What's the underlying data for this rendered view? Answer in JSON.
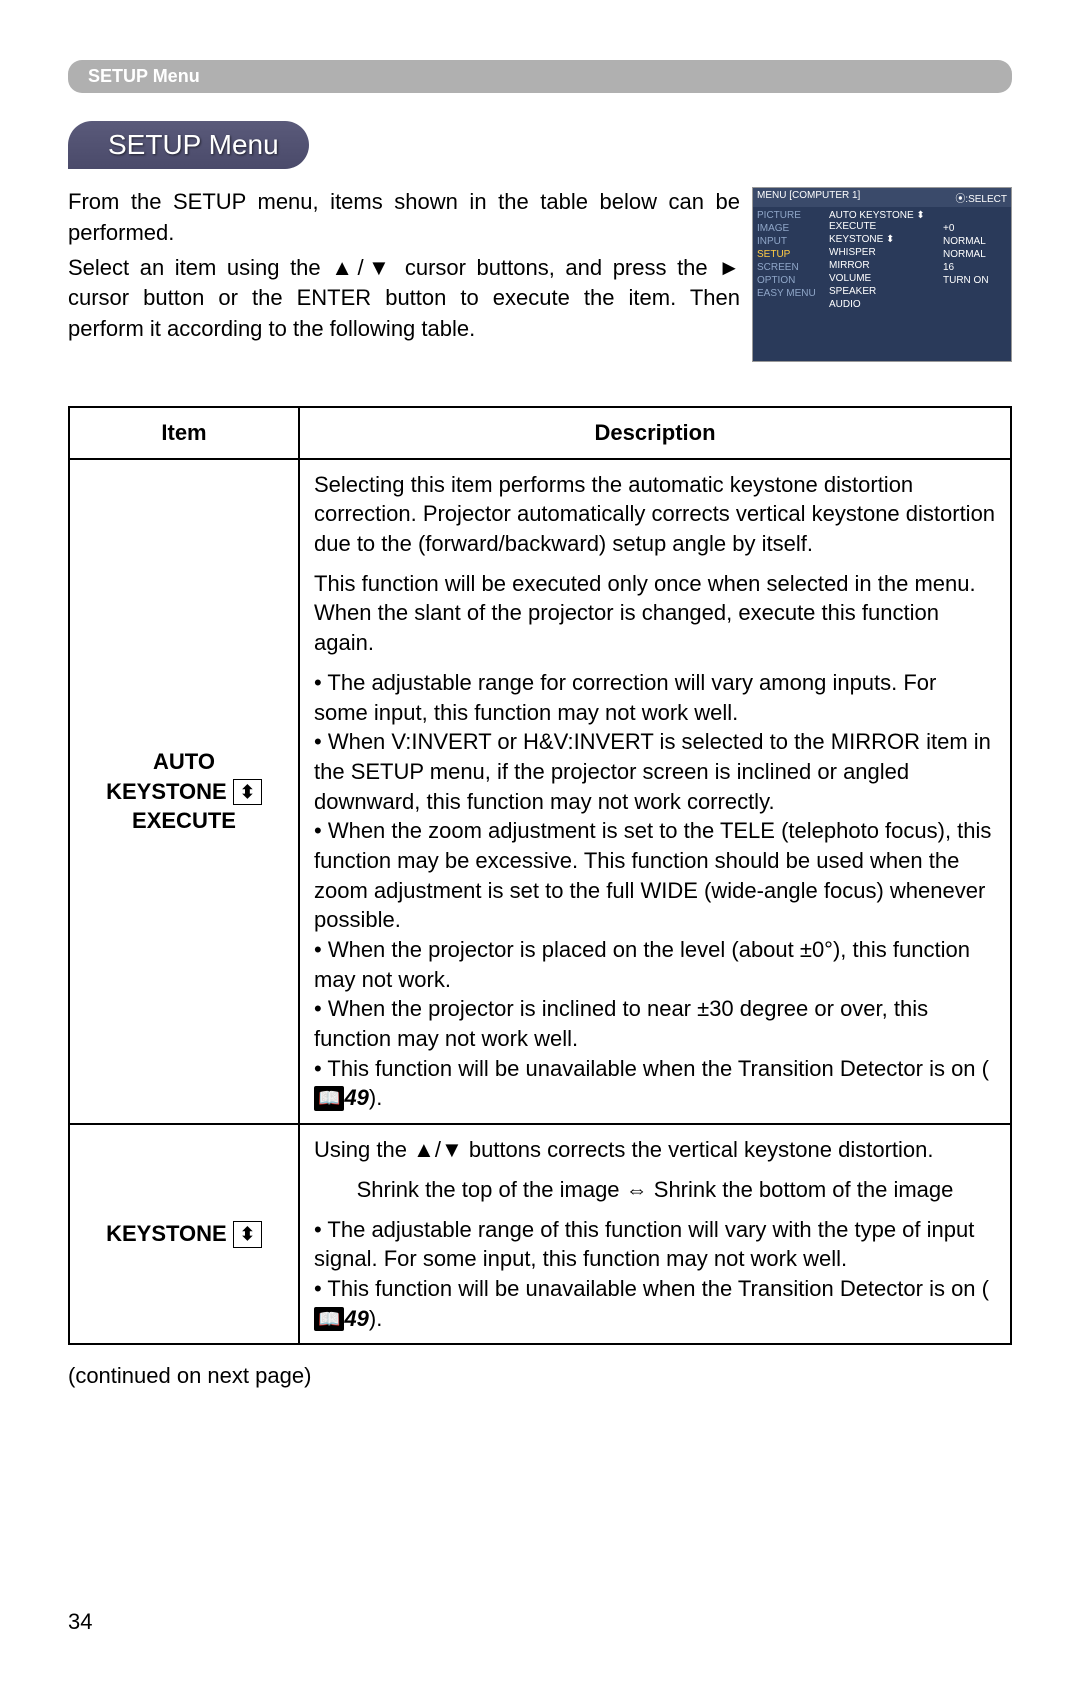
{
  "banner": "SETUP Menu",
  "title": "SETUP Menu",
  "intro": {
    "p1": "From the SETUP menu, items shown in the table below can be performed.",
    "p2": "Select an item using the ▲/▼ cursor buttons, and press the ► cursor button or the ENTER button to execute the item. Then perform it according to the following table."
  },
  "menu_shot": {
    "header_left": "MENU [COMPUTER 1]",
    "header_right": "⦿:SELECT",
    "left": [
      "PICTURE",
      "IMAGE",
      "INPUT",
      "SETUP",
      "SCREEN",
      "OPTION",
      "EASY MENU"
    ],
    "highlight_index": 3,
    "mid": [
      "AUTO KEYSTONE ⬍ EXECUTE",
      "KEYSTONE ⬍",
      "WHISPER",
      "MIRROR",
      "VOLUME",
      "SPEAKER",
      "AUDIO"
    ],
    "right": [
      "",
      "+0",
      "NORMAL",
      "NORMAL",
      "16",
      "TURN ON",
      ""
    ]
  },
  "table": {
    "head_item": "Item",
    "head_desc": "Description",
    "rows": [
      {
        "item_lines": [
          "AUTO",
          "KEYSTONE",
          "EXECUTE"
        ],
        "item_has_trap_after_keystone": true,
        "paras": [
          "Selecting this item performs the automatic keystone distortion correction. Projector automatically corrects vertical keystone distortion due to the (forward/backward) setup angle by itself.",
          "This function will be executed only once when selected in the menu. When the slant of the projector is changed, execute this function again.",
          "• The adjustable range for correction will vary among inputs. For some input, this function may not work well.\n• When V:INVERT or H&V:INVERT is selected to the MIRROR item in the SETUP menu, if the projector screen is inclined or angled downward, this function may not work correctly.\n• When the zoom adjustment is set to the TELE (telephoto focus), this function may be excessive. This function should be used when the zoom adjustment is set to the full WIDE (wide-angle focus) whenever possible.\n• When the projector is placed on the level (about ±0°), this function may not work.\n• When the projector is inclined to near ±30 degree or over, this function may not work well.\n• This function will be unavailable when the Transition Detector is on (📖49)."
        ]
      },
      {
        "item_label": "KEYSTONE",
        "item_trap": true,
        "paras": [
          "Using the ▲/▼ buttons corrects the vertical keystone distortion.",
          "Shrink the top of the image ⇔ Shrink the bottom of the image",
          "• The adjustable range of this function will vary with the type of input signal. For some input, this function may not work well.\n• This function will be unavailable when the Transition Detector is on (📖49)."
        ]
      }
    ]
  },
  "continued": "(continued on next page)",
  "page": "34"
}
